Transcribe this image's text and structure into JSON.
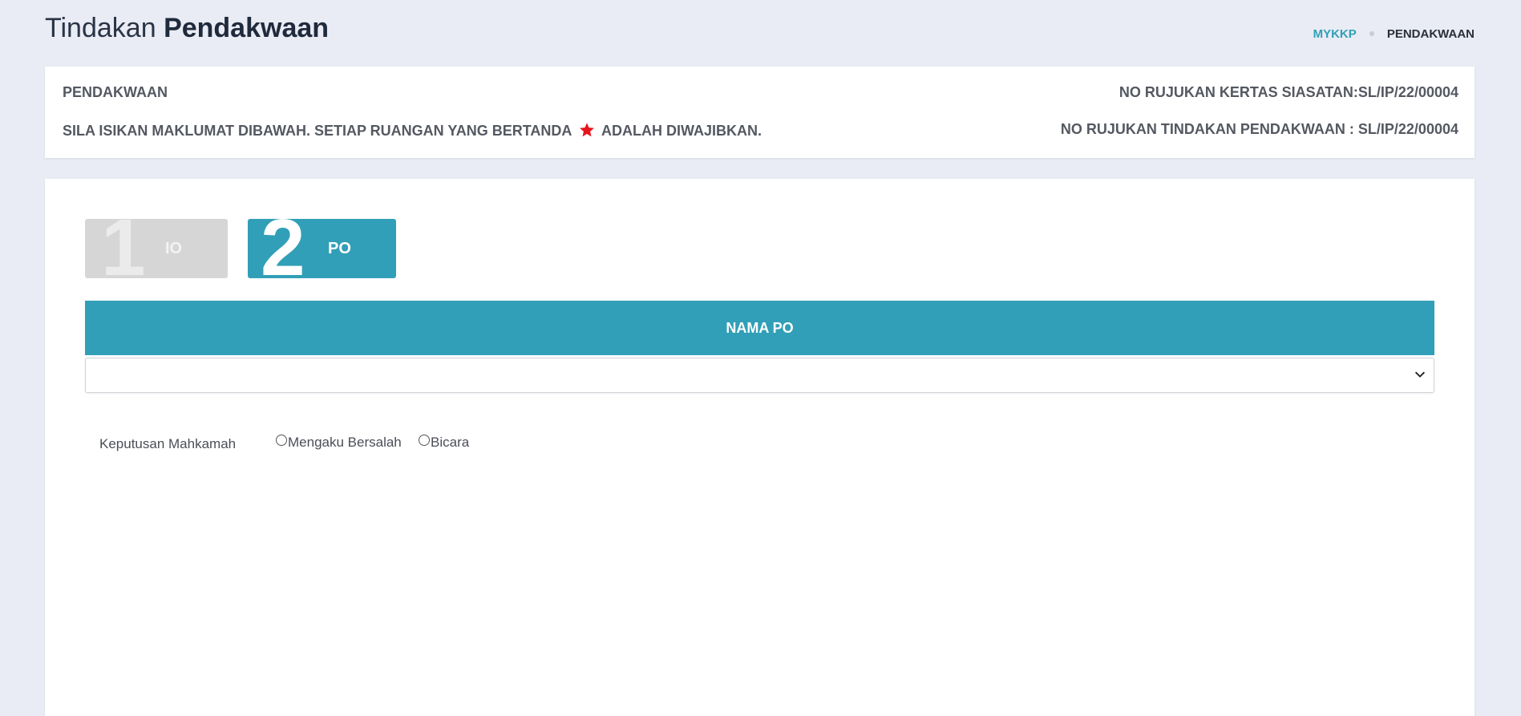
{
  "header": {
    "title_light": "Tindakan",
    "title_bold": "Pendakwaan",
    "breadcrumb": {
      "root": "MYKKP",
      "current": "PENDAKWAAN"
    }
  },
  "info": {
    "section": "PENDAKWAAN",
    "instruction_prefix": "SILA ISIKAN MAKLUMAT DIBAWAH. SETIAP RUANGAN YANG BERTANDA",
    "instruction_suffix": "ADALAH DIWAJIBKAN.",
    "ref_kertas_siasatan": "NO RUJUKAN KERTAS SIASATAN:SL/IP/22/00004",
    "ref_tindakan_pendakwaan": "NO RUJUKAN TINDAKAN PENDAKWAAN : SL/IP/22/00004",
    "star_color": "#e8141b"
  },
  "steps": [
    {
      "number": "1",
      "label": "IO",
      "active": false
    },
    {
      "number": "2",
      "label": "PO",
      "active": true
    }
  ],
  "form": {
    "section_title": "NAMA PO",
    "nama_po_value": "",
    "keputusan_label": "Keputusan Mahkamah",
    "options": [
      "Mengaku Bersalah",
      "Bicara"
    ]
  },
  "colors": {
    "accent": "#319fb7",
    "inactive_step": "#d6d6d6",
    "background": "#e9ecf4"
  }
}
